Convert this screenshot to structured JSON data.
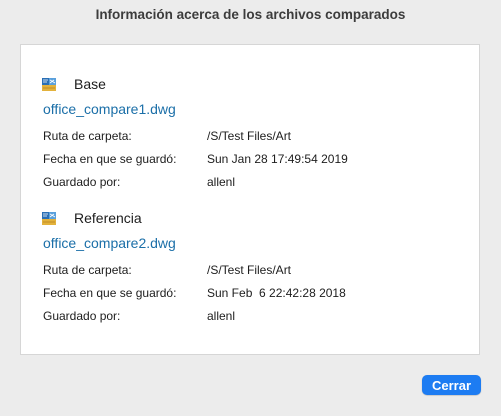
{
  "dialog": {
    "title": "Información acerca de los archivos comparados",
    "close_label": "Cerrar",
    "accent": "#1d7cf2"
  },
  "base": {
    "label": "Base",
    "icon": "dwg-file-icon",
    "file_name": "office_compare1.dwg",
    "fields": [
      {
        "label": "Ruta de carpeta:",
        "value": "/S/Test Files/Art"
      },
      {
        "label": "Fecha en que se guardó:",
        "value": "Sun Jan 28 17:49:54 2019"
      },
      {
        "label": "Guardado por:",
        "value": "allenl"
      }
    ]
  },
  "reference": {
    "label": "Referencia",
    "icon": "dwg-file-icon",
    "file_name": "office_compare2.dwg",
    "fields": [
      {
        "label": "Ruta de carpeta:",
        "value": "/S/Test Files/Art"
      },
      {
        "label": "Fecha en que se guardó:",
        "value": "Sun Feb  6 22:42:28 2018"
      },
      {
        "label": "Guardado por:",
        "value": "allenl"
      }
    ]
  }
}
